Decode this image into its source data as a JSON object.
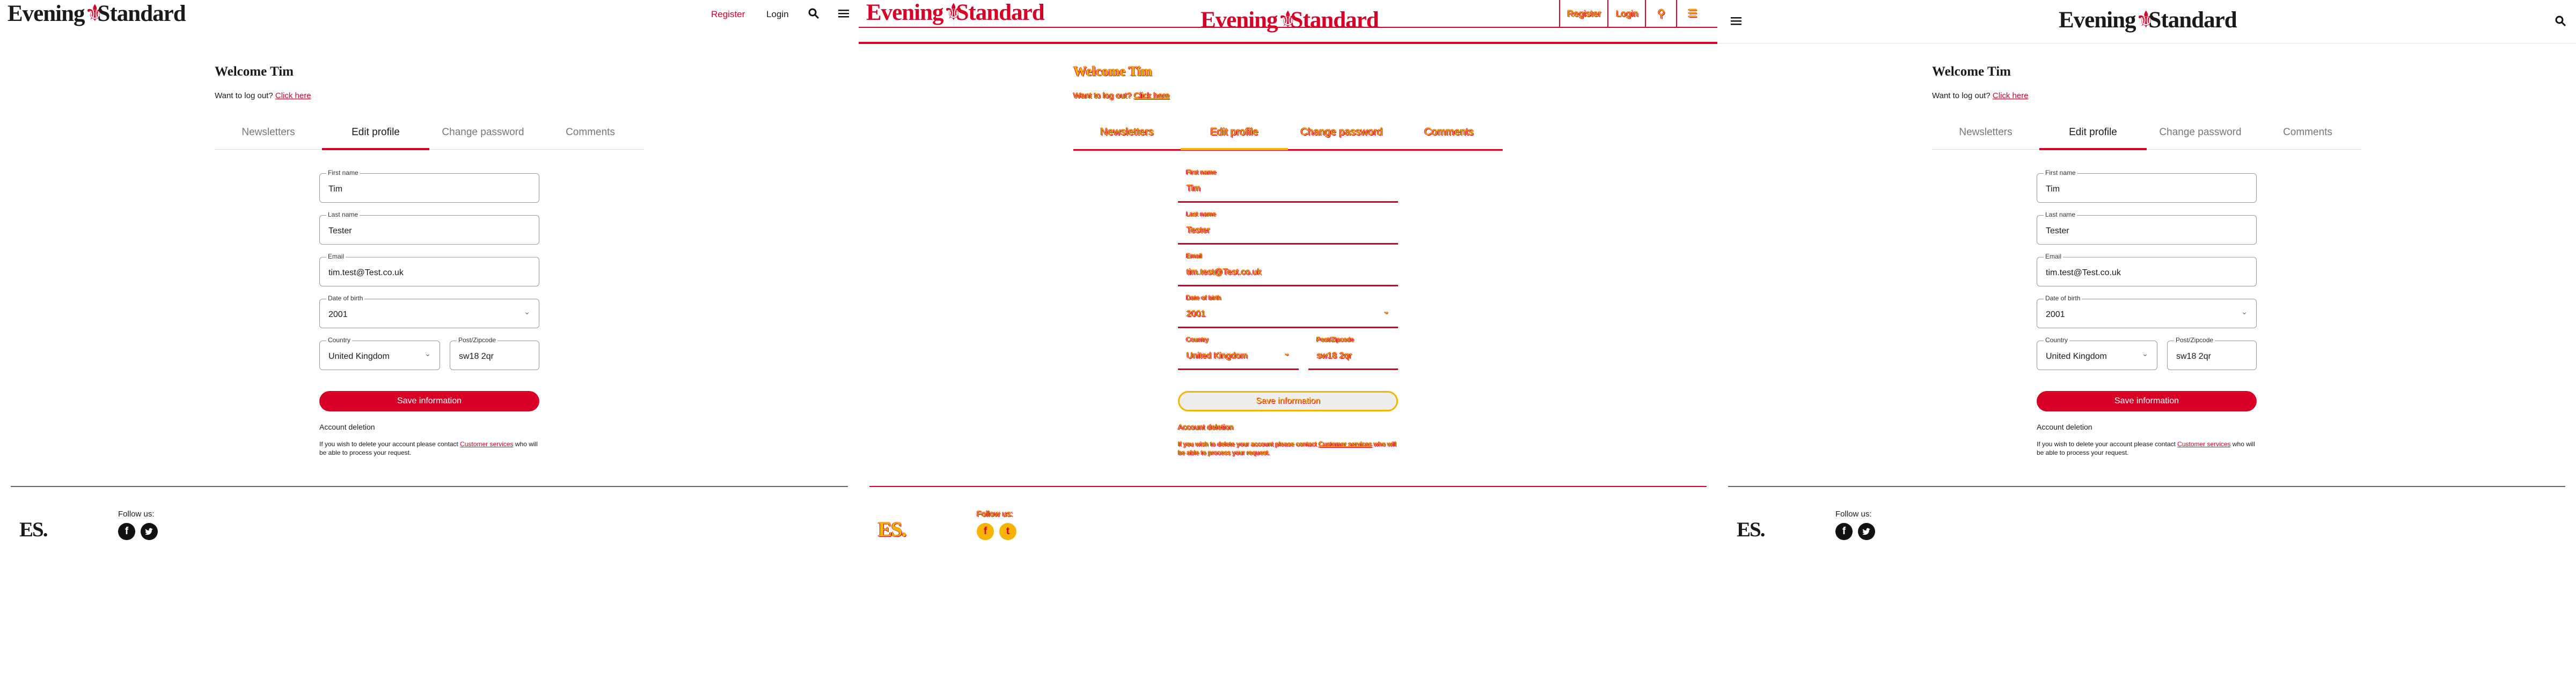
{
  "colors": {
    "accent": "#d90027",
    "glitch_yellow": "#f6b400"
  },
  "header": {
    "logo": "Evening Standard",
    "register": "Register",
    "login": "Login"
  },
  "account": {
    "welcome": "Welcome Tim",
    "logout_prompt": "Want to log out?",
    "logout_link": "Click here"
  },
  "tabs": [
    "Newsletters",
    "Edit profile",
    "Change password",
    "Comments"
  ],
  "active_tab": "Edit profile",
  "form": {
    "first_name": {
      "label": "First name",
      "value": "Tim"
    },
    "last_name": {
      "label": "Last name",
      "value": "Tester"
    },
    "email": {
      "label": "Email",
      "value": "tim.test@Test.co.uk"
    },
    "dob": {
      "label": "Date of birth",
      "value": "2001"
    },
    "country": {
      "label": "Country",
      "value": "United Kingdom"
    },
    "postcode": {
      "label": "Post/Zipcode",
      "value": "sw18 2qr"
    },
    "save_label": "Save information"
  },
  "deletion": {
    "heading": "Account deletion",
    "text_before": "If you wish to delete your account please contact",
    "link": "Customer services",
    "text_after": "who will be able to process your request."
  },
  "footer": {
    "logo": "ES.",
    "follow": "Follow us:",
    "social": [
      "facebook-icon",
      "twitter-icon"
    ]
  },
  "icons": [
    "search-icon",
    "menu-icon"
  ]
}
